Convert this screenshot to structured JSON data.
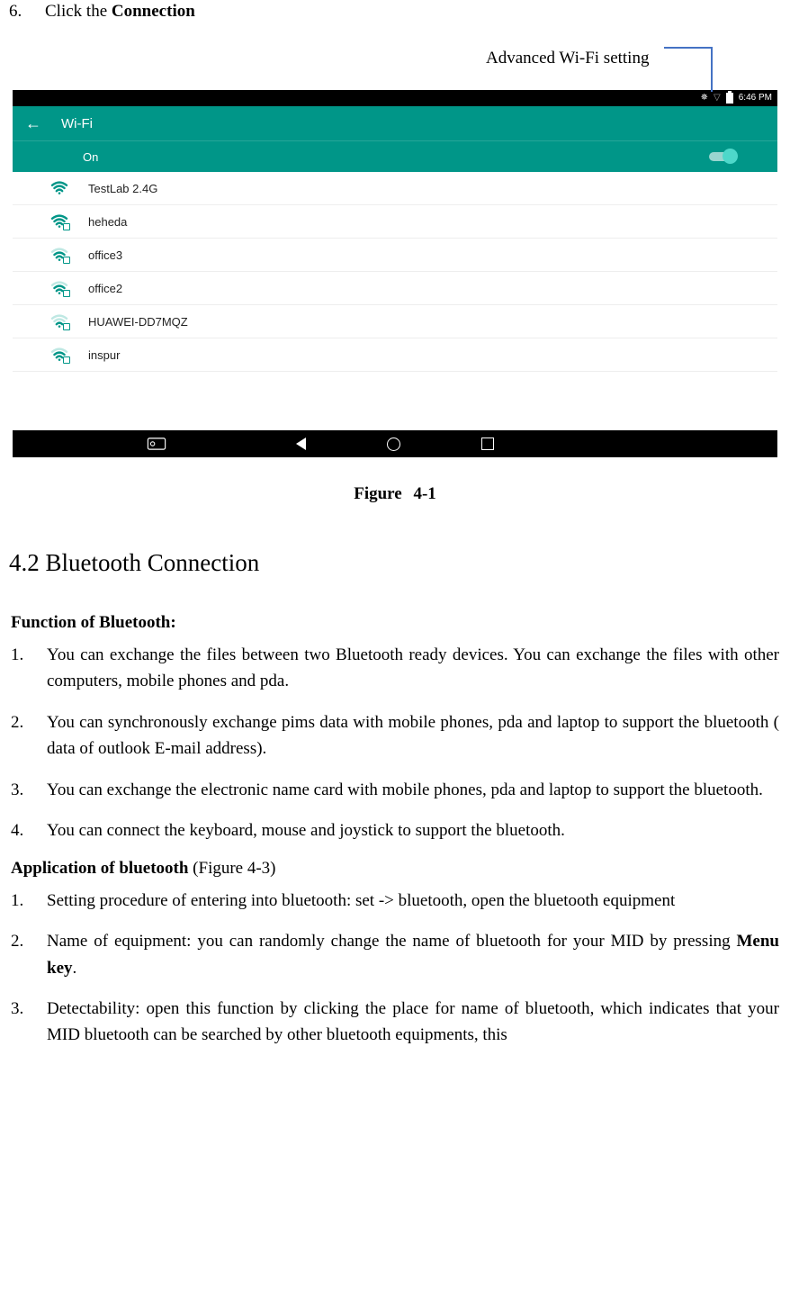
{
  "step6": {
    "num": "6.",
    "prefix": "Click the ",
    "bold": "Connection"
  },
  "annotation": "Advanced Wi-Fi setting",
  "android": {
    "time": "6:46 PM",
    "title": "Wi-Fi",
    "on_label": "On",
    "networks": [
      {
        "ssid": "TestLab 2.4G",
        "strength": "full",
        "locked": false
      },
      {
        "ssid": "heheda",
        "strength": "full",
        "locked": true
      },
      {
        "ssid": "office3",
        "strength": "mid",
        "locked": true
      },
      {
        "ssid": "office2",
        "strength": "mid",
        "locked": true
      },
      {
        "ssid": "HUAWEI-DD7MQZ",
        "strength": "low",
        "locked": true
      },
      {
        "ssid": "inspur",
        "strength": "mid",
        "locked": true
      }
    ]
  },
  "figure_label": "Figure  4-1",
  "section_heading": "4.2 Bluetooth Connection",
  "bluetooth_function_heading": "Function of Bluetooth:",
  "bluetooth_function_items": [
    "You can exchange the files between two Bluetooth ready devices. You can exchange the files with other computers, mobile phones and pda.",
    "You can synchronously exchange pims data with mobile phones, pda and laptop to support the bluetooth ( data of outlook E-mail address).",
    "You can exchange the electronic name card with mobile phones, pda and laptop to support the bluetooth.",
    "You can connect the keyboard, mouse and joystick to support the bluetooth."
  ],
  "bluetooth_app_heading_bold": "Application of bluetooth",
  "bluetooth_app_heading_rest": " (Figure 4-3)",
  "bluetooth_app_items": [
    {
      "text": "Setting procedure of entering into bluetooth: set -> bluetooth, open the bluetooth equipment"
    },
    {
      "text_pre": "Name of equipment: you can randomly change the name of bluetooth for your MID by pressing ",
      "bold": "Menu key",
      "text_post": "."
    },
    {
      "text": "Detectability: open this function by clicking the place for name of bluetooth, which indicates that your MID bluetooth can be searched by other bluetooth equipments, this"
    }
  ]
}
